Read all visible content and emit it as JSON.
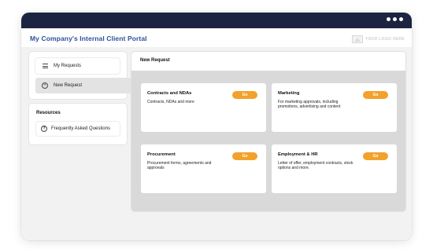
{
  "app": {
    "title": "My Company's Internal Client Portal",
    "logo_placeholder": "YOUR LOGO HERE"
  },
  "nav": {
    "items": [
      {
        "label": "My Requests",
        "icon": "list-icon"
      },
      {
        "label": "New Request",
        "icon": "plus-circle-icon",
        "selected": true
      }
    ]
  },
  "resources": {
    "title": "Resources",
    "items": [
      {
        "label": "Frequently Asked Questions",
        "icon": "question-circle-icon"
      }
    ]
  },
  "main": {
    "title": "New Request",
    "cards": [
      {
        "title": "Contracts and NDAs",
        "description": "Contracts, NDAs and more",
        "button": "Go"
      },
      {
        "title": "Marketing",
        "description": "For marketing approvals, including promotions, advertising and content",
        "button": "Go"
      },
      {
        "title": "Procurement",
        "description": "Procurement forms, agreements and approvals",
        "button": "Go"
      },
      {
        "title": "Employment & HR",
        "description": "Letter of offer, employment contracts, stock options and more.",
        "button": "Go"
      }
    ]
  },
  "colors": {
    "titlebar": "#1c2442",
    "title_text": "#2f4f9e",
    "go_button": "#f2a12b",
    "panel_bg": "#d9d9d9"
  }
}
